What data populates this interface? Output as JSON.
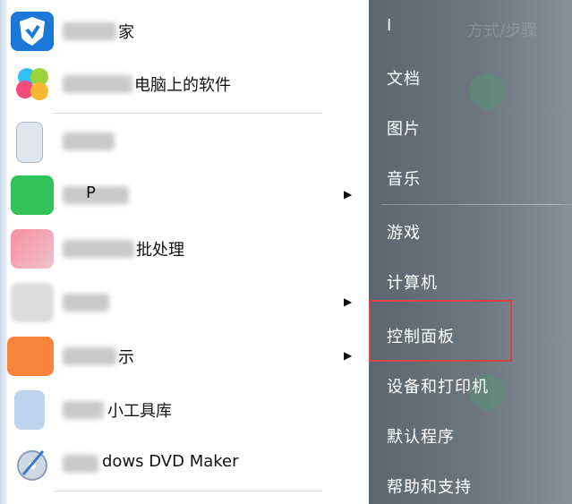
{
  "left_menu": {
    "items": [
      {
        "name": "item-1",
        "visible_text": "家",
        "has_arrow": false
      },
      {
        "name": "item-2",
        "visible_text": "电脑上的软件",
        "has_arrow": false
      },
      {
        "name": "item-3",
        "visible_text": "",
        "has_arrow": false
      },
      {
        "name": "item-4",
        "visible_text": "P",
        "has_arrow": true
      },
      {
        "name": "item-5",
        "visible_text": "批处理",
        "has_arrow": false
      },
      {
        "name": "item-6",
        "visible_text": "",
        "has_arrow": true
      },
      {
        "name": "item-7",
        "visible_text": "示",
        "has_arrow": true
      },
      {
        "name": "item-8",
        "visible_text": "小工具库",
        "has_arrow": false
      },
      {
        "name": "item-9",
        "visible_text": "dows DVD Maker",
        "has_arrow": false
      }
    ],
    "arrow_glyph": "▶"
  },
  "right_menu": {
    "user": "I",
    "items": [
      "文档",
      "图片",
      "音乐",
      "游戏",
      "计算机",
      "控制面板",
      "设备和打印机",
      "默认程序",
      "帮助和支持"
    ],
    "highlighted": "控制面板"
  },
  "colors": {
    "highlight_border": "#d44545",
    "right_bg": "#6c7780"
  }
}
